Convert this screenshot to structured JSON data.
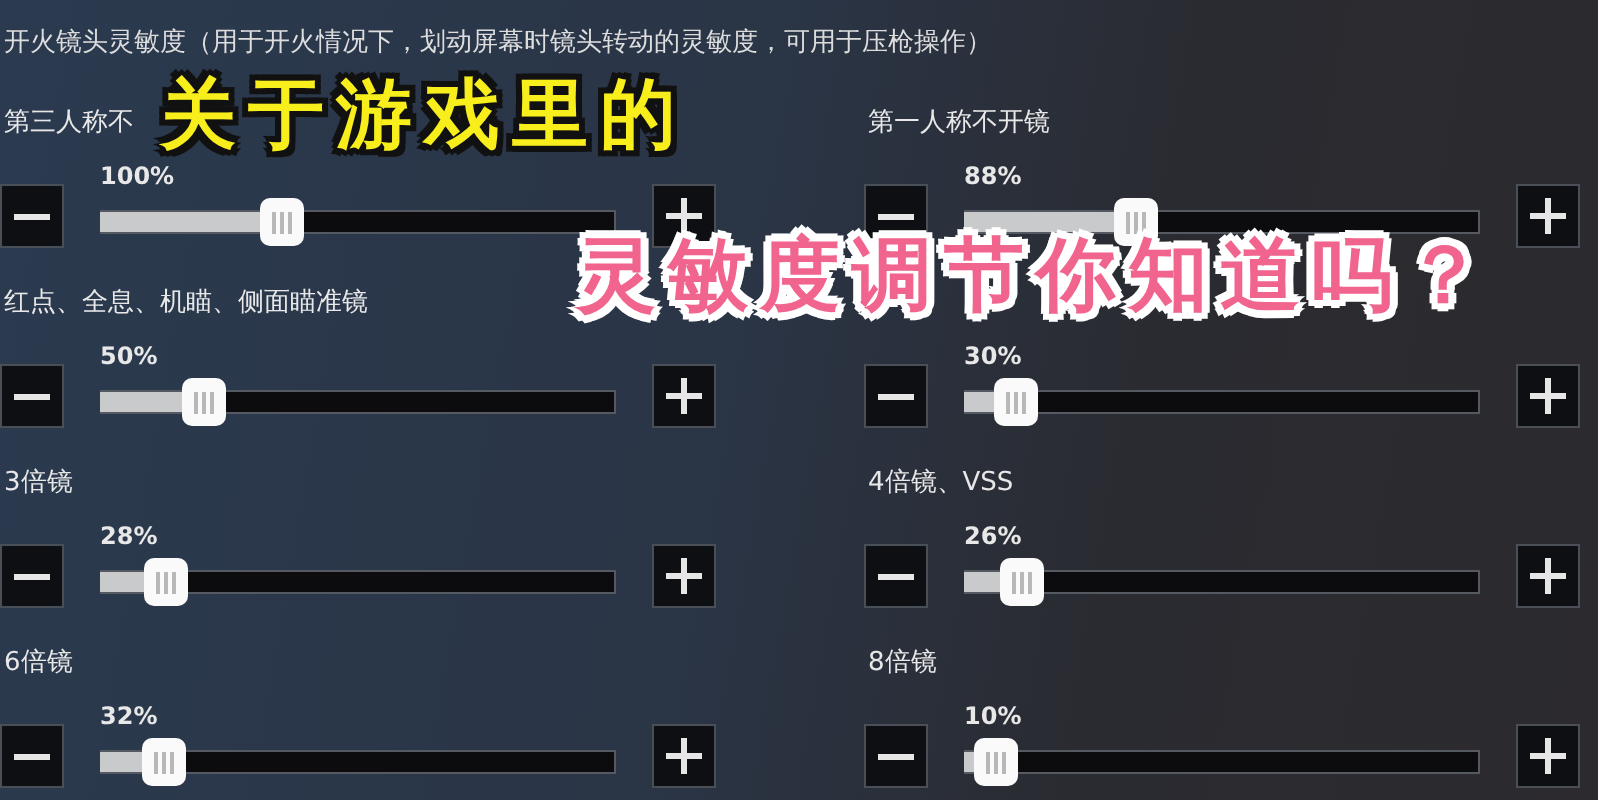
{
  "header": "开火镜头灵敏度（用于开火情况下，划动屏幕时镜头转动的灵敏度，可用于压枪操作）",
  "overlay_title": {
    "line_1": "关于游戏里的",
    "line_2": "灵敏度调节你知道吗？"
  },
  "sliders": [
    {
      "label": "第三人称不",
      "reading": "100%",
      "level": 0.31
    },
    {
      "label": "第一人称不开镜",
      "reading": "88%",
      "level": 0.29
    },
    {
      "label": "红点、全息、机瞄、侧面瞄准镜",
      "reading": "50%",
      "level": 0.16
    },
    {
      "reading": "30%",
      "level": 0.06
    },
    {
      "label": "3倍镜",
      "reading": "28%",
      "level": 0.085
    },
    {
      "label": "4倍镜、VSS",
      "reading": "26%",
      "level": 0.07
    },
    {
      "label": "6倍镜",
      "reading": "32%",
      "level": 0.08
    },
    {
      "label": "8倍镜",
      "reading": "10%",
      "level": 0.02
    }
  ]
}
